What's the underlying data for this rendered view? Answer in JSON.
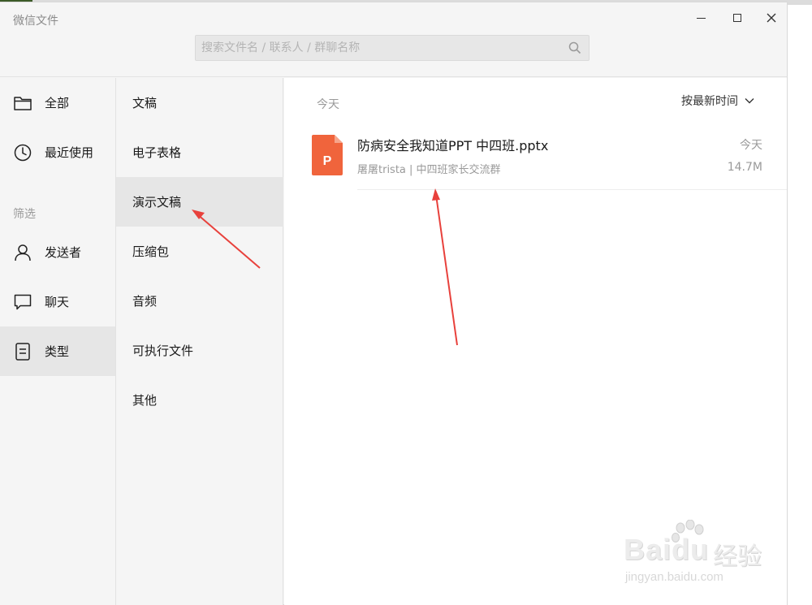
{
  "window": {
    "title": "微信文件"
  },
  "search": {
    "placeholder": "搜索文件名 / 联系人 / 群聊名称"
  },
  "sidebar": {
    "items": [
      {
        "label": "全部",
        "icon": "folder-icon"
      },
      {
        "label": "最近使用",
        "icon": "clock-icon"
      }
    ],
    "filter_label": "筛选",
    "filters": [
      {
        "label": "发送者",
        "icon": "person-icon"
      },
      {
        "label": "聊天",
        "icon": "chat-bubble-icon"
      },
      {
        "label": "类型",
        "icon": "document-icon",
        "active": true
      }
    ]
  },
  "types": {
    "items": [
      {
        "label": "文稿"
      },
      {
        "label": "电子表格"
      },
      {
        "label": "演示文稿",
        "active": true
      },
      {
        "label": "压缩包"
      },
      {
        "label": "音频"
      },
      {
        "label": "可执行文件"
      },
      {
        "label": "其他"
      }
    ]
  },
  "main": {
    "group_label": "今天",
    "sort_label": "按最新时间",
    "files": [
      {
        "icon": "ppt-file-icon",
        "icon_letter": "P",
        "name": "防病安全我知道PPT 中四班.pptx",
        "meta": "屠屠trista | 中四班家长交流群",
        "date": "今天",
        "size": "14.7M"
      }
    ]
  },
  "colors": {
    "ppt_icon": "#f0643c",
    "annotation_arrow": "#e8413c",
    "active_bg": "#e6e6e6"
  },
  "watermark": {
    "brand": "Baidu",
    "brand_cn": "经验",
    "url": "jingyan.baidu.com"
  }
}
